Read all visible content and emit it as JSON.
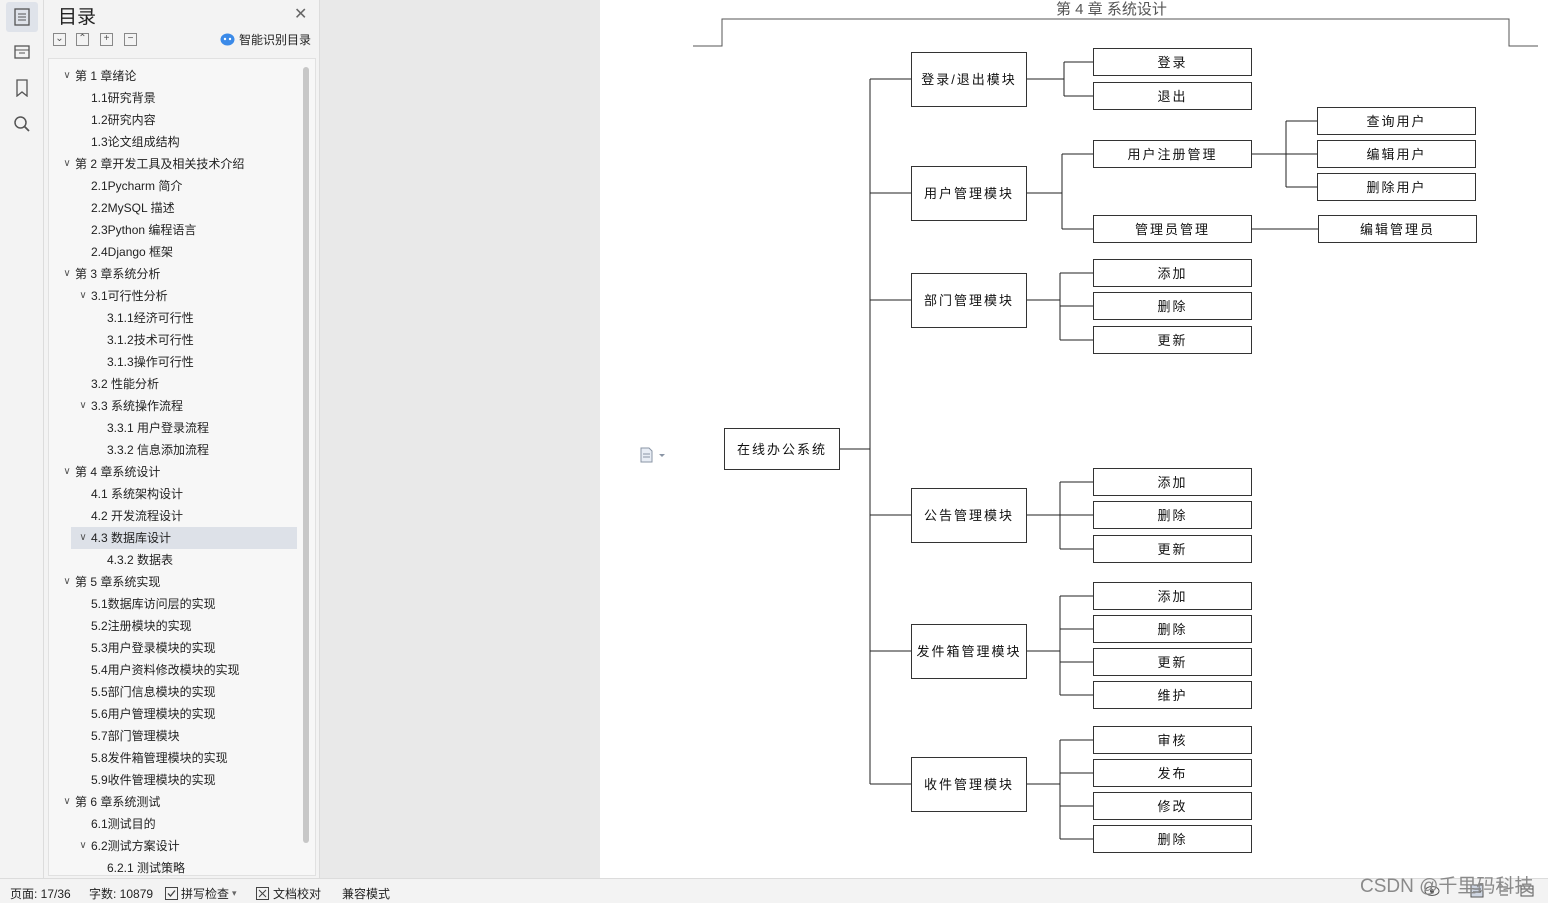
{
  "toc": {
    "title": "目录",
    "smart_label": "智能识别目录",
    "items": [
      {
        "label": "第 1 章绪论",
        "level": 0,
        "expanded": true
      },
      {
        "label": "1.1研究背景",
        "level": 1
      },
      {
        "label": "1.2研究内容",
        "level": 1
      },
      {
        "label": "1.3论文组成结构",
        "level": 1
      },
      {
        "label": "第 2 章开发工具及相关技术介绍",
        "level": 0,
        "expanded": true
      },
      {
        "label": "2.1Pycharm 简介",
        "level": 1
      },
      {
        "label": "2.2MySQL 描述",
        "level": 1
      },
      {
        "label": "2.3Python 编程语言",
        "level": 1
      },
      {
        "label": "2.4Django 框架",
        "level": 1
      },
      {
        "label": "第 3 章系统分析",
        "level": 0,
        "expanded": true
      },
      {
        "label": "3.1可行性分析",
        "level": 1,
        "expanded": true
      },
      {
        "label": "3.1.1经济可行性",
        "level": 2
      },
      {
        "label": "3.1.2技术可行性",
        "level": 2
      },
      {
        "label": "3.1.3操作可行性",
        "level": 2
      },
      {
        "label": "3.2 性能分析",
        "level": 1
      },
      {
        "label": "3.3 系统操作流程",
        "level": 1,
        "expanded": true
      },
      {
        "label": "3.3.1 用户登录流程",
        "level": 2
      },
      {
        "label": "3.3.2 信息添加流程",
        "level": 2
      },
      {
        "label": "第 4 章系统设计",
        "level": 0,
        "expanded": true
      },
      {
        "label": "4.1 系统架构设计",
        "level": 1
      },
      {
        "label": "4.2 开发流程设计",
        "level": 1
      },
      {
        "label": "4.3 数据库设计",
        "level": 1,
        "expanded": true,
        "selected": true
      },
      {
        "label": "4.3.2 数据表",
        "level": 2
      },
      {
        "label": "第 5 章系统实现",
        "level": 0,
        "expanded": true
      },
      {
        "label": "5.1数据库访问层的实现",
        "level": 1
      },
      {
        "label": "5.2注册模块的实现",
        "level": 1
      },
      {
        "label": "5.3用户登录模块的实现",
        "level": 1
      },
      {
        "label": "5.4用户资料修改模块的实现",
        "level": 1
      },
      {
        "label": "5.5部门信息模块的实现",
        "level": 1
      },
      {
        "label": "5.6用户管理模块的实现",
        "level": 1
      },
      {
        "label": "5.7部门管理模块",
        "level": 1
      },
      {
        "label": "5.8发件箱管理模块的实现",
        "level": 1
      },
      {
        "label": "5.9收件管理模块的实现",
        "level": 1
      },
      {
        "label": "第 6 章系统测试",
        "level": 0,
        "expanded": true
      },
      {
        "label": "6.1测试目的",
        "level": 1
      },
      {
        "label": "6.2测试方案设计",
        "level": 1,
        "expanded": true
      },
      {
        "label": "6.2.1 测试策略",
        "level": 2
      }
    ]
  },
  "document": {
    "header": "第 4 章  系统设计",
    "diagram": {
      "root": "在线办公系统",
      "modules": [
        {
          "label": "登录/退出模块",
          "children": [
            {
              "label": "登录"
            },
            {
              "label": "退出"
            }
          ]
        },
        {
          "label": "用户管理模块",
          "children": [
            {
              "label": "用户注册管理",
              "children": [
                "查询用户",
                "编辑用户",
                "删除用户"
              ]
            },
            {
              "label": "管理员管理",
              "children": [
                "编辑管理员"
              ]
            }
          ]
        },
        {
          "label": "部门管理模块",
          "children": [
            {
              "label": "添加"
            },
            {
              "label": "删除"
            },
            {
              "label": "更新"
            }
          ]
        },
        {
          "label": "公告管理模块",
          "children": [
            {
              "label": "添加"
            },
            {
              "label": "删除"
            },
            {
              "label": "更新"
            }
          ]
        },
        {
          "label": "发件箱管理模块",
          "children": [
            {
              "label": "添加"
            },
            {
              "label": "删除"
            },
            {
              "label": "更新"
            },
            {
              "label": "维护"
            }
          ]
        },
        {
          "label": "收件管理模块",
          "children": [
            {
              "label": "审核"
            },
            {
              "label": "发布"
            },
            {
              "label": "修改"
            },
            {
              "label": "删除"
            }
          ]
        }
      ]
    }
  },
  "status": {
    "page": "页面: 17/36",
    "words": "字数: 10879",
    "spellcheck": "拼写检查",
    "proofread": "文档校对",
    "compat": "兼容模式"
  },
  "watermark": "CSDN @千里码科技"
}
